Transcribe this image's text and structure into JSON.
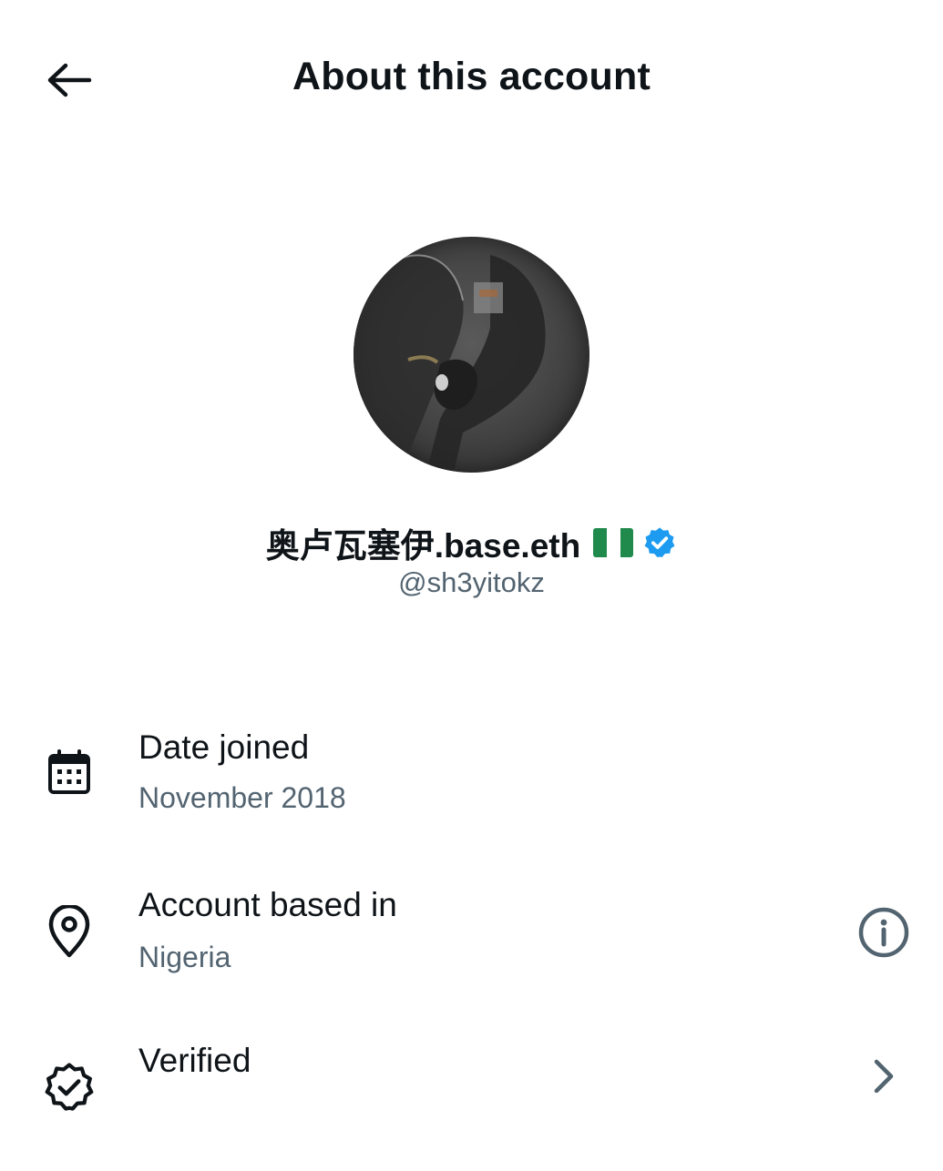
{
  "header": {
    "title": "About this account",
    "back_icon": "arrow-left-icon"
  },
  "profile": {
    "display_name": "奥卢瓦塞伊.base.eth",
    "flag": "Nigeria flag emoji",
    "verified_icon": "verified-badge-icon",
    "verified_color": "#1d9bf0",
    "handle": "@sh3yitokz"
  },
  "details": [
    {
      "icon": "calendar-icon",
      "label": "Date joined",
      "value": "November 2018"
    },
    {
      "icon": "location-pin-icon",
      "label": "Account based in",
      "value": "Nigeria",
      "action_icon": "info-icon"
    },
    {
      "icon": "verified-outline-icon",
      "label": "Verified",
      "action_icon": "chevron-right-icon"
    }
  ],
  "colors": {
    "text_primary": "#0f1419",
    "text_secondary": "#536471",
    "background": "#ffffff"
  }
}
